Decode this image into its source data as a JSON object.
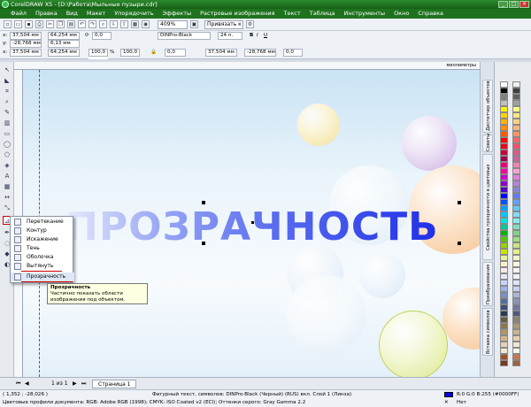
{
  "window": {
    "title": "CorelDRAW X5 - [D:\\Работа\\Мыльные пузыри.cdr]"
  },
  "menu": [
    "Файл",
    "Правка",
    "Вид",
    "Макет",
    "Упорядочить",
    "Эффекты",
    "Растровые изображения",
    "Текст",
    "Таблица",
    "Инструменты",
    "Окно",
    "Справка"
  ],
  "toolbar": {
    "zoom": "409%",
    "snap": "Привязать к"
  },
  "propbar": {
    "x": "37,504 мм",
    "y": "-28,768 мм",
    "w": "64,254 мм",
    "h": "6,13 мм",
    "angle": "0,0",
    "font": "DINPro-Black",
    "size": "24 п.",
    "x2": "37,504 мм",
    "y2": "-28,768 мм",
    "w2": "64,254 мм",
    "h2": "6,13 мм",
    "sx": "100,0",
    "sy": "100,0",
    "pct": "%",
    "rot": "0,0",
    "px": "37,504 мм",
    "py": "-28,768 мм",
    "deg": "0,0"
  },
  "ruler": {
    "unit": "миллиметры"
  },
  "canvas": {
    "text": "ПРОЗРАЧНОСТЬ"
  },
  "flyout": {
    "items": [
      "Перетекание",
      "Контур",
      "Искажение",
      "Тень",
      "Оболочка",
      "Вытянуть",
      "Прозрачность"
    ],
    "highlight_color": "#cc0000"
  },
  "tooltip": {
    "title": "Прозрачность",
    "body": "Частично показать области изображения под объектом."
  },
  "dockers": [
    "Диспетчер объектов",
    "Советы",
    "Свойства прозрачности в цветовых профилях",
    "Преобразования",
    "Вставка символов"
  ],
  "pages": {
    "counter": "1 из 1",
    "tab": "Страница 1"
  },
  "status": {
    "coords": "( 1,352 ; -28,026 )",
    "object": "Фигурный текст, символов: DINPro-Black (Черный) (RUS) вкл. Слой 1 (Линза)",
    "profiles": "Цветовые профили документа: RGB: Adobe RGB (1998); CMYK: ISO Coated v2 (ECI); Оттенки серого: Gray Gamma 2.2",
    "fill": "R:0 G:0 B:255 (#0000FF)",
    "outline": "Нет"
  },
  "colors": {
    "accent": "#1e721e",
    "text_blue": "#1f2fe8"
  }
}
